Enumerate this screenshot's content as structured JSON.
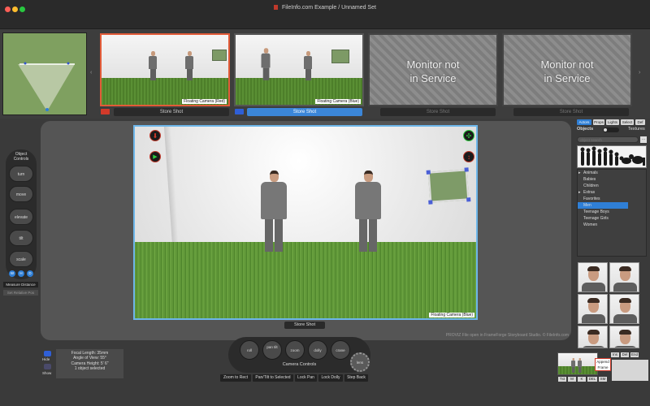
{
  "window": {
    "title": "FileInfo.com Example / Unnamed Set"
  },
  "shots": [
    {
      "camera_label": "Floating Camera (Red)",
      "store_label": "Store Shot",
      "active": false
    },
    {
      "camera_label": "Floating Camera (Blue)",
      "store_label": "Store Shot",
      "active": true
    },
    {
      "monitor_text_1": "Monitor not",
      "monitor_text_2": "in Service",
      "store_label": "Store Shot"
    },
    {
      "monitor_text_1": "Monitor not",
      "monitor_text_2": "in Service",
      "store_label": "Store Shot"
    }
  ],
  "object_controls": {
    "title_1": "Object",
    "title_2": "Controls",
    "buttons": [
      "turn",
      "move",
      "elevate",
      "tilt",
      "scale"
    ],
    "mode_buttons": [
      "W",
      "H",
      "D"
    ],
    "measure_label": "Measure Distance",
    "relative_label": "Set Relative Pos"
  },
  "viewport": {
    "camera_label": "Floating Camera (Blue)",
    "store_label": "Store Shot"
  },
  "status_text": "PROVIZ File open in FrameForge Storyboard Studio. © FileInfo.com",
  "right_panel": {
    "tabs": [
      "Actors",
      "Props",
      "Lights",
      "Select",
      "Def"
    ],
    "objects_label": "Objects",
    "textures_label": "Textures",
    "search_placeholder": "object search",
    "categories": [
      {
        "label": "Animals",
        "expandable": true
      },
      {
        "label": "Babies",
        "expandable": false
      },
      {
        "label": "Children",
        "expandable": false
      },
      {
        "label": "Extras",
        "expandable": true
      },
      {
        "label": "Favorites",
        "expandable": false
      },
      {
        "label": "Men",
        "expandable": false,
        "selected": true
      },
      {
        "label": "Teenage Boys",
        "expandable": false
      },
      {
        "label": "Teenage Girls",
        "expandable": false
      },
      {
        "label": "Women",
        "expandable": false
      }
    ]
  },
  "camera_info": {
    "hide_label": "Hide",
    "show_label": "Show",
    "focal_length": "Focal Length: 35mm",
    "angle_of_view": "Angle of View: 55°",
    "camera_height": "Camera Height: 5' 6\"",
    "selection": "1 object selected"
  },
  "camera_controls": {
    "title": "Camera Controls",
    "knobs": [
      "roll",
      "pan tilt",
      "zoom",
      "dolly",
      "crane"
    ],
    "lens_label": "lens",
    "buttons": [
      "Zoom to Rect",
      "Pan/Tilt to Selected",
      "Lock Pan",
      "Lock Dolly",
      "Step Back"
    ]
  },
  "frame_panel": {
    "append_line_1": "Append",
    "append_line_2": "Frame",
    "top_buttons": [
      "Ins",
      "Del",
      "End"
    ],
    "bottom_buttons": [
      "Txt",
      "M",
      "K",
      "DEL",
      "SM"
    ]
  },
  "colors": {
    "accent_blue": "#2f7fd6",
    "red": "#d23a2a",
    "active_store": "#3b86d8"
  }
}
